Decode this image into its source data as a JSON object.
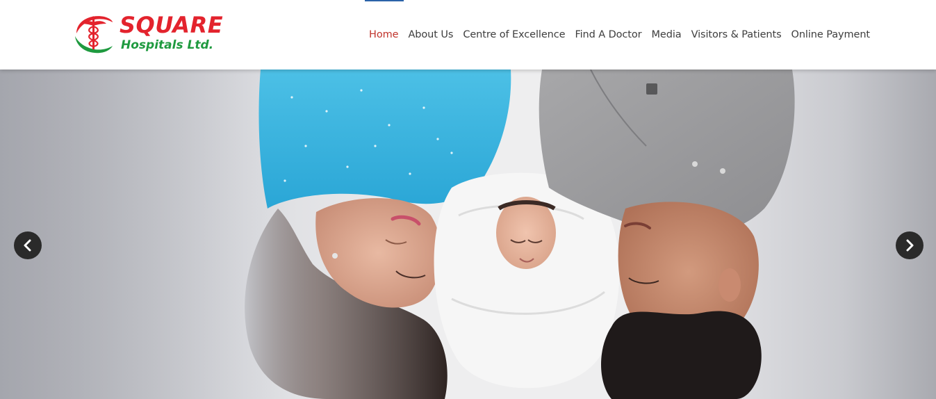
{
  "brand": {
    "name_line1": "SQUARE",
    "name_line2": "Hospitals Ltd.",
    "red": "#e3232d",
    "green": "#1f9a3f"
  },
  "nav": {
    "items": [
      {
        "label": "Home",
        "active": true
      },
      {
        "label": "About Us",
        "active": false
      },
      {
        "label": "Centre of Excellence",
        "active": false
      },
      {
        "label": "Find A Doctor",
        "active": false
      },
      {
        "label": "Media",
        "active": false
      },
      {
        "label": "Visitors & Patients",
        "active": false
      },
      {
        "label": "Online Payment",
        "active": false
      }
    ],
    "active_color": "#c0332b",
    "text_color": "#3d3d3d"
  },
  "slider": {
    "prev_icon": "chevron-left-icon",
    "next_icon": "chevron-right-icon",
    "image_subject": "family-with-newborn-photo"
  }
}
